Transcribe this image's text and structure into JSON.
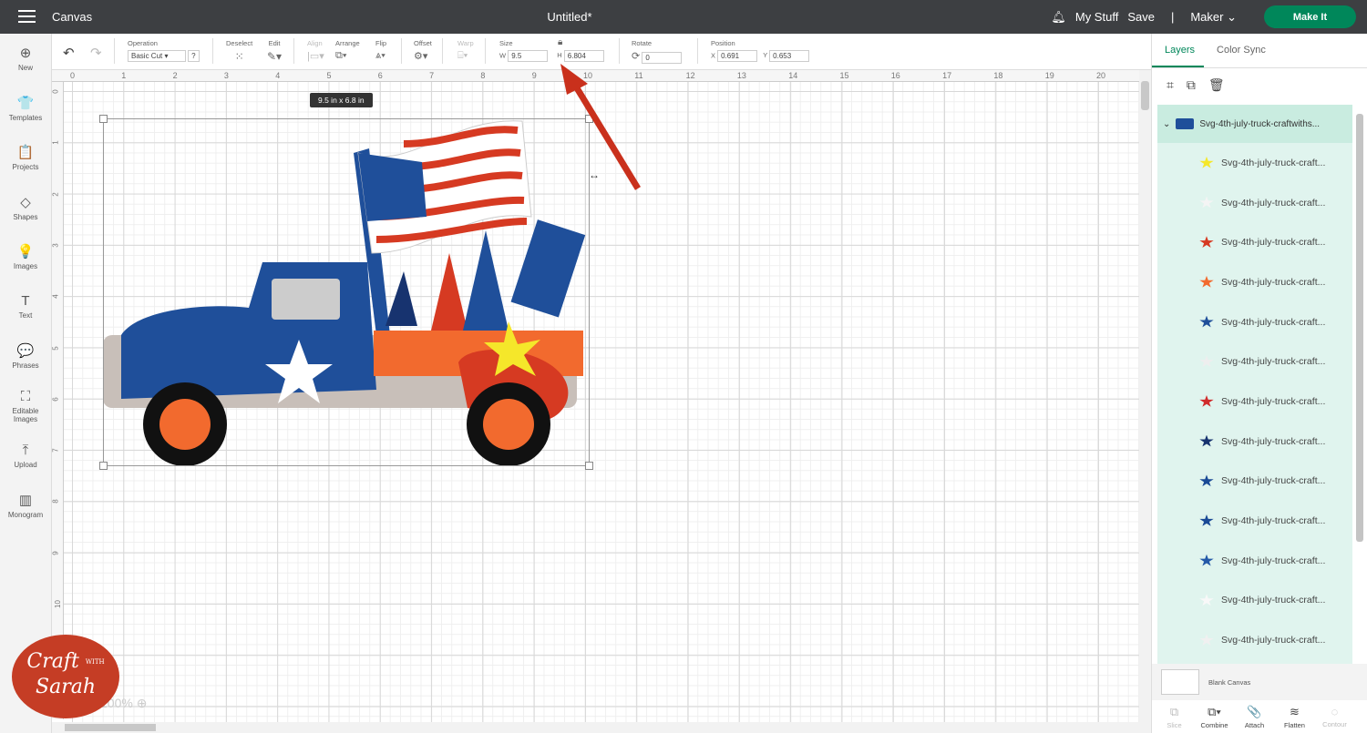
{
  "topbar": {
    "app": "Canvas",
    "title": "Untitled*",
    "my_stuff": "My Stuff",
    "save": "Save",
    "divider": "|",
    "machine": "Maker",
    "make_it": "Make It"
  },
  "left_nav": [
    {
      "label": "New",
      "icon": "⊕"
    },
    {
      "label": "Templates",
      "icon": "👕"
    },
    {
      "label": "Projects",
      "icon": "📋"
    },
    {
      "label": "Shapes",
      "icon": "◇"
    },
    {
      "label": "Images",
      "icon": "💡"
    },
    {
      "label": "Text",
      "icon": "T"
    },
    {
      "label": "Phrases",
      "icon": "💬"
    },
    {
      "label": "Editable Images",
      "icon": "⛶"
    },
    {
      "label": "Upload",
      "icon": "⤒"
    },
    {
      "label": "Monogram",
      "icon": "▥"
    }
  ],
  "toolbar": {
    "operation_label": "Operation",
    "operation_value": "Basic Cut",
    "help": "?",
    "deselect": "Deselect",
    "edit": "Edit",
    "align": "Align",
    "arrange": "Arrange",
    "flip": "Flip",
    "offset": "Offset",
    "warp": "Warp",
    "size_label": "Size",
    "w_label": "W",
    "w_value": "9.5",
    "h_label": "H",
    "h_value": "6.804",
    "rotate_label": "Rotate",
    "rotate_value": "0",
    "position_label": "Position",
    "x_label": "X",
    "x_value": "0.691",
    "y_label": "Y",
    "y_value": "0.653"
  },
  "ruler_h": [
    "0",
    "1",
    "2",
    "3",
    "4",
    "5",
    "6",
    "7",
    "8",
    "9",
    "10",
    "11",
    "12",
    "13",
    "14",
    "15",
    "16",
    "17",
    "18",
    "19",
    "20"
  ],
  "ruler_v": [
    "0",
    "1",
    "2",
    "3",
    "4",
    "5",
    "6",
    "7",
    "8",
    "9",
    "10"
  ],
  "canvas": {
    "size_tooltip": "9.5  in x 6.8  in",
    "zoom": "100%"
  },
  "panel": {
    "tabs": [
      "Layers",
      "Color Sync"
    ],
    "group_name": "Svg-4th-july-truck-craftwiths...",
    "layers": [
      {
        "name": "Svg-4th-july-truck-craft...",
        "color": "#f5e72a"
      },
      {
        "name": "Svg-4th-july-truck-craft...",
        "color": "#f4f4f4"
      },
      {
        "name": "Svg-4th-july-truck-craft...",
        "color": "#d63a22"
      },
      {
        "name": "Svg-4th-july-truck-craft...",
        "color": "#f26a2e"
      },
      {
        "name": "Svg-4th-july-truck-craft...",
        "color": "#1f4f9a"
      },
      {
        "name": "Svg-4th-july-truck-craft...",
        "color": "#eeeeee"
      },
      {
        "name": "Svg-4th-july-truck-craft...",
        "color": "#d02c2c"
      },
      {
        "name": "Svg-4th-july-truck-craft...",
        "color": "#17336f"
      },
      {
        "name": "Svg-4th-july-truck-craft...",
        "color": "#1a4a96"
      },
      {
        "name": "Svg-4th-july-truck-craft...",
        "color": "#1a4a96"
      },
      {
        "name": "Svg-4th-july-truck-craft...",
        "color": "#2459a8"
      },
      {
        "name": "Svg-4th-july-truck-craft...",
        "color": "#f8f8f8"
      },
      {
        "name": "Svg-4th-july-truck-craft...",
        "color": "#f0f0f0"
      }
    ],
    "blank_canvas": "Blank Canvas",
    "tools": [
      {
        "label": "Slice",
        "icon": "⧉"
      },
      {
        "label": "Combine",
        "icon": "⧉▾"
      },
      {
        "label": "Attach",
        "icon": "📎"
      },
      {
        "label": "Flatten",
        "icon": "≋"
      },
      {
        "label": "Contour",
        "icon": "◌"
      }
    ]
  },
  "watermark": {
    "line1": "Craft",
    "with": "WITH",
    "line2": "Sarah"
  }
}
